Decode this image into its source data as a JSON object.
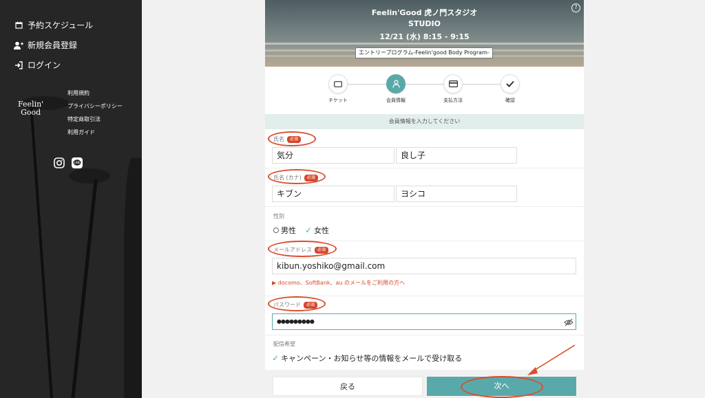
{
  "sidebar": {
    "nav": [
      {
        "label": "予約スケジュール",
        "icon": "calendar-icon"
      },
      {
        "label": "新規会員登録",
        "icon": "user-plus-icon"
      },
      {
        "label": "ログイン",
        "icon": "login-icon"
      }
    ],
    "logo_line1": "Feelin'",
    "logo_line2": "Good",
    "links": [
      "利用規約",
      "プライバシーポリシー",
      "特定商取引法",
      "利用ガイド"
    ],
    "social": [
      "instagram-icon",
      "line-icon"
    ]
  },
  "hero": {
    "title": "Feelin'Good 虎ノ門スタジオ",
    "subtitle": "STUDIO",
    "datetime": "12/21 (水) 8:15 - 9:15",
    "program": "エントリープログラム-Feelin'good Body Program-",
    "help_icon": "?"
  },
  "steps": [
    {
      "label": "チケット",
      "icon": "ticket-icon",
      "active": false
    },
    {
      "label": "会員情報",
      "icon": "user-icon",
      "active": true
    },
    {
      "label": "支払方法",
      "icon": "credit-card-icon",
      "active": false
    },
    {
      "label": "確認",
      "icon": "checkmark-icon",
      "active": false
    }
  ],
  "form": {
    "header": "会員情報を入力してください",
    "required_badge": "必須",
    "name_label": "氏名",
    "last_name": "気分",
    "first_name": "良し子",
    "kana_label": "氏名 (カナ)",
    "last_kana": "キブン",
    "first_kana": "ヨシコ",
    "gender_label": "性別",
    "gender_male": "男性",
    "gender_female": "女性",
    "gender_selected": "女性",
    "email_label": "メールアドレス",
    "email": "kibun.yoshiko@gmail.com",
    "email_note": "▶ docomo、SoftBank、au のメールをご利用の方へ",
    "password_label": "パスワード",
    "password": "●●●●●●●●●",
    "delivery_label": "配信希望",
    "delivery_option": "キャンペーン・お知らせ等の情報をメールで受け取る",
    "delivery_checked": true
  },
  "buttons": {
    "back": "戻る",
    "next": "次へ"
  },
  "colors": {
    "accent": "#5aa9aa",
    "required": "#d6472c",
    "annotation": "#d94d2d"
  }
}
